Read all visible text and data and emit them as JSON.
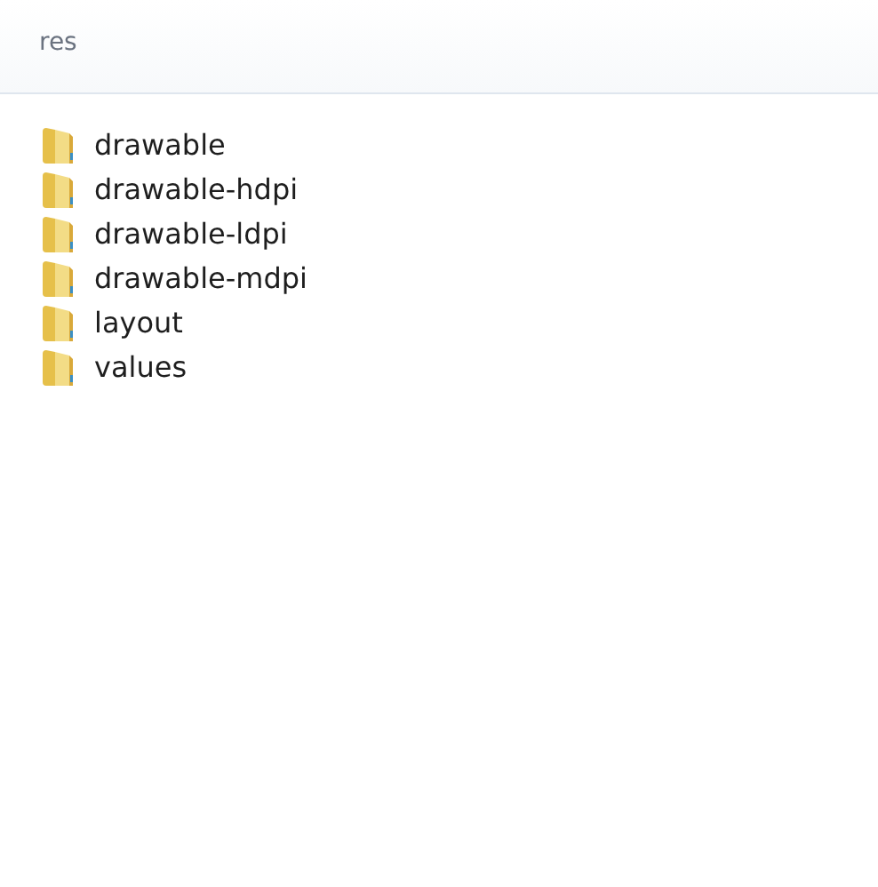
{
  "header": {
    "title": "res"
  },
  "items": [
    {
      "name": "drawable"
    },
    {
      "name": "drawable-hdpi"
    },
    {
      "name": "drawable-ldpi"
    },
    {
      "name": "drawable-mdpi"
    },
    {
      "name": "layout"
    },
    {
      "name": "values"
    }
  ]
}
